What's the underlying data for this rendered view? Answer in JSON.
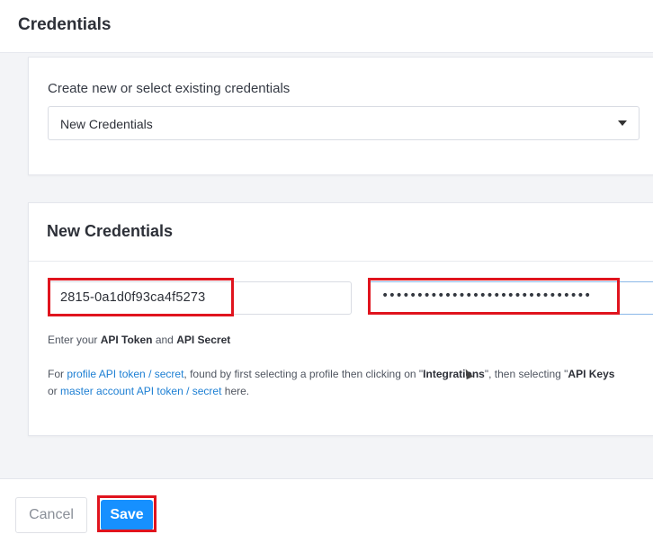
{
  "header": {
    "title": "Credentials"
  },
  "select_card": {
    "label": "Create new or select existing credentials",
    "selected": "New Credentials"
  },
  "new_card": {
    "title": "New Credentials",
    "api_token_value": "2815-0a1d0f93ca4f5273",
    "api_secret_masked": "••••••••••••••••••••••••••••••",
    "help_prefix": "Enter your ",
    "help_token": "API Token",
    "help_and": " and ",
    "help_secret": "API Secret",
    "help2_for": "For ",
    "help2_link1": "profile API token / secret",
    "help2_mid": ", found by first selecting a profile then clicking on \"",
    "help2_integrations": "Integrations",
    "help2_then": "\", then selecting \"",
    "help2_apikeys": "API Keys",
    "help2_or": "or ",
    "help2_link2": "master account API token / secret",
    "help2_here": " here."
  },
  "footer": {
    "cancel_label": "Cancel",
    "save_label": "Save"
  },
  "colors": {
    "highlight": "#e0141e",
    "primary": "#1690ff",
    "link": "#1d7fd3"
  },
  "icons": {
    "select_caret": "caret-down-icon",
    "mouse": "mouse-cursor-icon"
  }
}
